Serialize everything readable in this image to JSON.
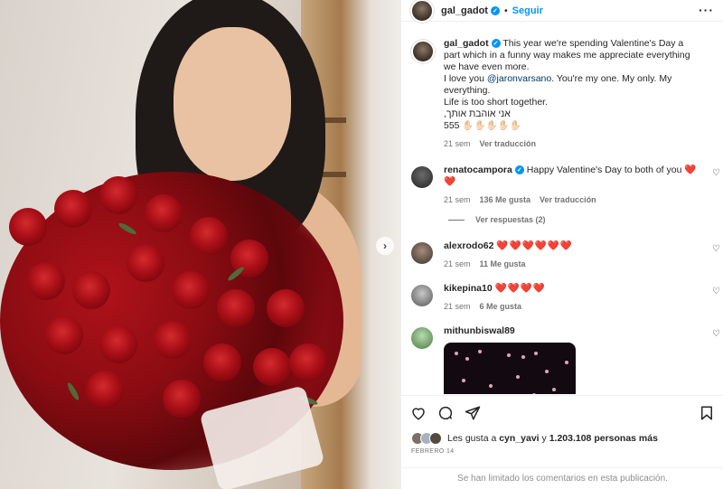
{
  "post": {
    "username": "gal_gadot",
    "follow_label": "Seguir",
    "caption_lines": [
      "This year we're spending Valentine's Day a part which in a funny way makes me appreciate everything we have even more.",
      "I love you",
      "@jaronvarsano",
      ". You're my one. My only. My everything.",
      "Life is too short together.",
      "אני אוהבת אותך,",
      "555 ✋🏻✋🏻✋🏻✋🏻✋🏻"
    ],
    "caption_time": "21 sem",
    "caption_translate": "Ver traducción"
  },
  "comments": [
    {
      "username": "renatocampora",
      "verified": true,
      "text": "Happy Valentine's Day to both of you",
      "emoji": "❤️❤️",
      "time": "21 sem",
      "likes": "136 Me gusta",
      "translate": "Ver traducción",
      "replies": "Ver respuestas (2)"
    },
    {
      "username": "alexrodo62",
      "emoji": "❤️❤️❤️❤️❤️❤️",
      "time": "21 sem",
      "likes": "11 Me gusta"
    },
    {
      "username": "kikepina10",
      "emoji": "❤️❤️❤️❤️",
      "time": "21 sem",
      "likes": "6 Me gusta"
    },
    {
      "username": "mithunbiswal89"
    }
  ],
  "likes_summary": {
    "prefix": "Les gusta a",
    "user": "cyn_yavi",
    "middle": "y",
    "count": "1.203.108 personas más"
  },
  "date": "Febrero 14",
  "limited_comments": "Se han limitado los comentarios en esta publicación.",
  "colors": {
    "accent": "#0095f6",
    "heart": "#ed2a2a",
    "muted": "#737373"
  },
  "icons": [
    "heart-icon",
    "comment-icon",
    "share-icon",
    "bookmark-icon",
    "more-icon",
    "verified-icon",
    "chevron-right-icon"
  ]
}
